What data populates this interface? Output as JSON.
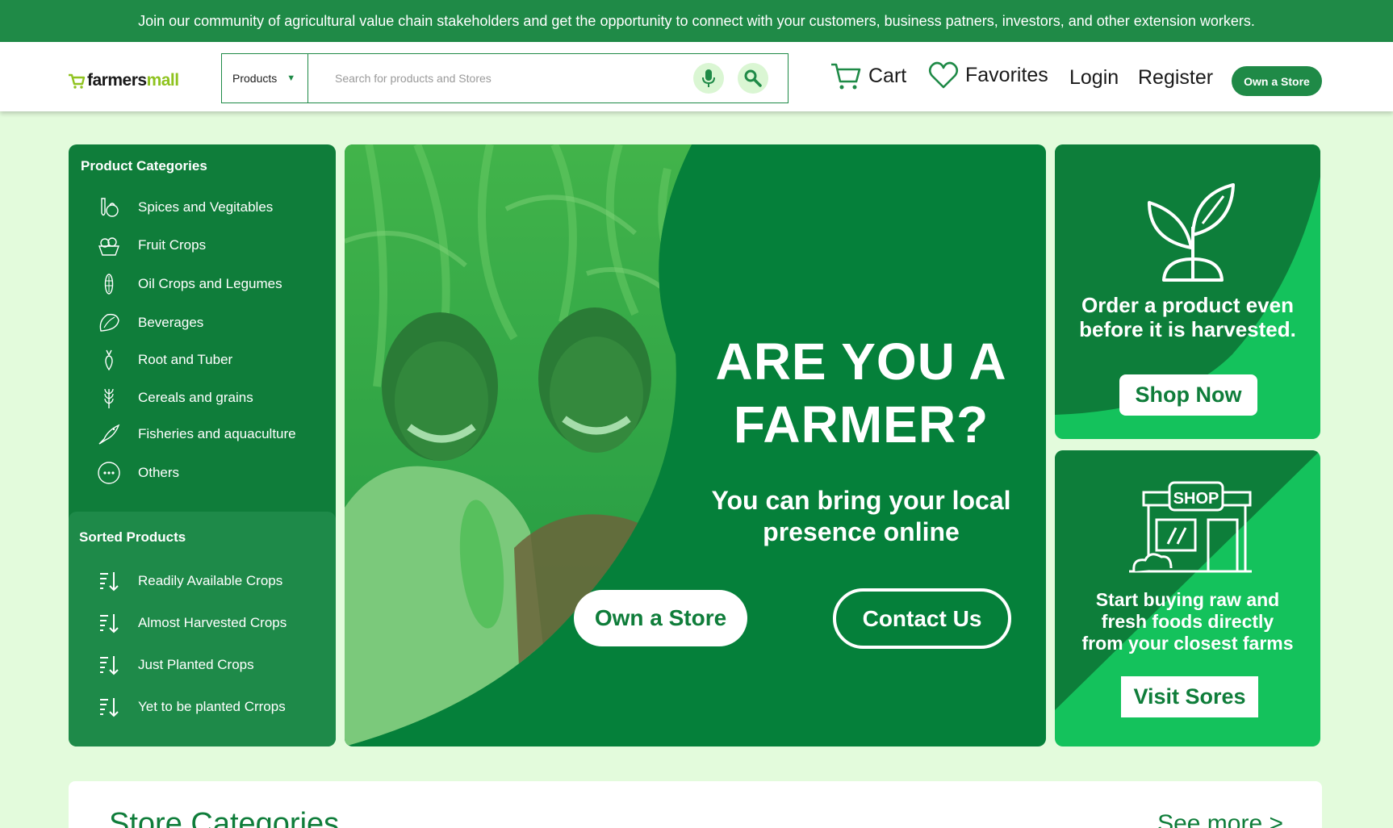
{
  "banner": {
    "text": "Join our community of agricultural value chain stakeholders and get the opportunity to connect with your customers, business patners, investors, and other extension workers."
  },
  "header": {
    "logo_part1": "farmers",
    "logo_part2": "mall",
    "search": {
      "category": "Products",
      "placeholder": "Search for products and Stores"
    },
    "nav": {
      "cart": "Cart",
      "favorites": "Favorites",
      "login": "Login",
      "register": "Register",
      "own_store": "Own a Store"
    }
  },
  "sidebar": {
    "title": "Product Categories",
    "categories": [
      {
        "label": "Spices and Vegitables",
        "icon": "vegetables-icon"
      },
      {
        "label": "Fruit Crops",
        "icon": "fruit-basket-icon"
      },
      {
        "label": "Oil Crops and Legumes",
        "icon": "corn-icon"
      },
      {
        "label": "Beverages",
        "icon": "cocoa-icon"
      },
      {
        "label": "Root and Tuber",
        "icon": "root-icon"
      },
      {
        "label": "Cereals and grains",
        "icon": "wheat-icon"
      },
      {
        "label": "Fisheries and aquaculture",
        "icon": "fish-icon"
      },
      {
        "label": "Others",
        "icon": "more-icon"
      }
    ],
    "sorted_title": "Sorted Products",
    "sorted": [
      {
        "label": "Readily Available Crops",
        "icon": "sort-icon"
      },
      {
        "label": "Almost Harvested Crops",
        "icon": "sort-icon"
      },
      {
        "label": "Just Planted Crops",
        "icon": "sort-icon"
      },
      {
        "label": "Yet to be planted Crrops",
        "icon": "sort-icon"
      }
    ]
  },
  "hero": {
    "heading_line1": "ARE YOU A",
    "heading_line2": "FARMER?",
    "subheading_line1": "You can bring your local",
    "subheading_line2": "presence online",
    "primary_button": "Own a Store",
    "secondary_button": "Contact Us"
  },
  "promo1": {
    "icon": "sprout-icon",
    "line1": "Order a product even",
    "line2": "before it is harvested.",
    "button": "Shop Now"
  },
  "promo2": {
    "icon": "shop-icon",
    "line1": "Start buying  raw and",
    "line2": "fresh foods directly",
    "line3": "from your closest farms",
    "button": "Visit Sores"
  },
  "store_categories": {
    "title": "Store Categories",
    "see_more": "See more >"
  },
  "colors": {
    "brand_dark": "#0f7d3a",
    "brand": "#1f8a47",
    "accent_light": "#14c25c",
    "background": "#e3fbdc"
  }
}
